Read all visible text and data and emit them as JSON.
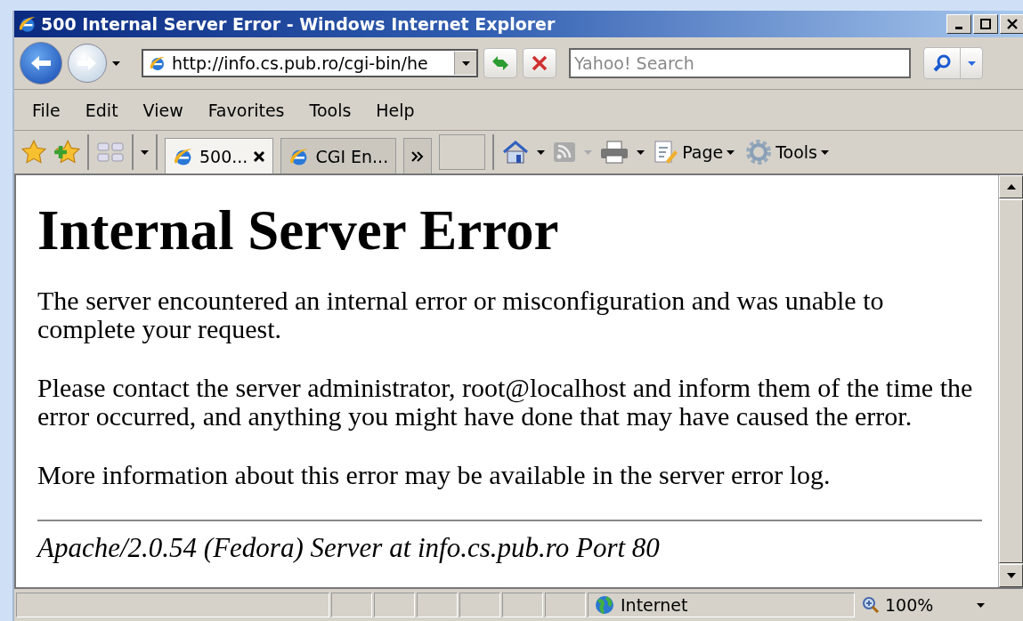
{
  "window": {
    "title": "500 Internal Server Error - Windows Internet Explorer"
  },
  "address": {
    "url": "http://info.cs.pub.ro/cgi-bin/he"
  },
  "search": {
    "placeholder": "Yahoo! Search"
  },
  "menu": [
    "File",
    "Edit",
    "View",
    "Favorites",
    "Tools",
    "Help"
  ],
  "tabs": [
    {
      "label": "500...",
      "selected": true
    },
    {
      "label": "CGI En...",
      "selected": false
    }
  ],
  "command_bar": [
    "Page",
    "Tools"
  ],
  "content": {
    "heading": "Internal Server Error",
    "paragraphs": [
      "The server encountered an internal error or misconfiguration and was unable to complete your request.",
      "Please contact the server administrator, root@localhost and inform them of the time the error occurred, and anything you might have done that may have caused the error.",
      "More information about this error may be available in the server error log."
    ],
    "footer": "Apache/2.0.54 (Fedora) Server at info.cs.pub.ro Port 80"
  },
  "status_bar": {
    "zone": "Internet",
    "zoom": "100%"
  }
}
